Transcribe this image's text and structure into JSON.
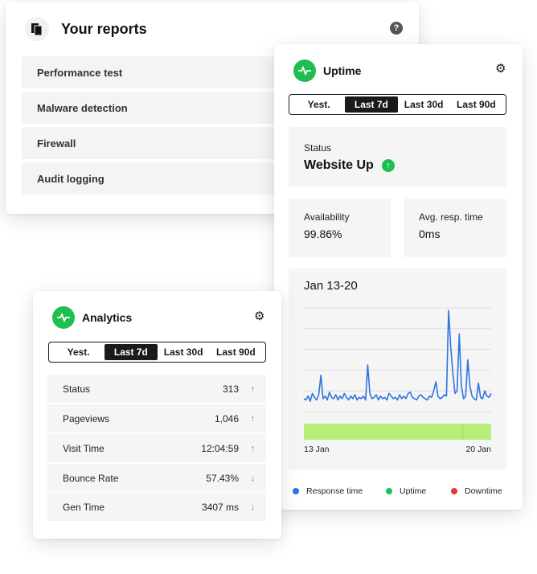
{
  "reports": {
    "title": "Your reports",
    "items": [
      "Performance test",
      "Malware detection",
      "Firewall",
      "Audit logging"
    ]
  },
  "uptime": {
    "title": "Uptime",
    "tabs": [
      "Yest.",
      "Last 7d",
      "Last 30d",
      "Last 90d"
    ],
    "active_tab": "Last 7d",
    "status_label": "Status",
    "status_value": "Website Up",
    "availability_label": "Availability",
    "availability_value": "99.86%",
    "resp_label": "Avg. resp. time",
    "resp_value": "0ms",
    "chart_title": "Jan 13-20",
    "x_start": "13 Jan",
    "x_end": "20 Jan",
    "legend": [
      {
        "label": "Response time",
        "color": "#2f74e0"
      },
      {
        "label": "Uptime",
        "color": "#1fbe4f"
      },
      {
        "label": "Downtime",
        "color": "#e53935"
      }
    ]
  },
  "analytics": {
    "title": "Analytics",
    "tabs": [
      "Yest.",
      "Last 7d",
      "Last 30d",
      "Last 90d"
    ],
    "active_tab": "Last 7d",
    "rows": [
      {
        "name": "Status",
        "value": "313",
        "trend": "up"
      },
      {
        "name": "Pageviews",
        "value": "1,046",
        "trend": "up"
      },
      {
        "name": "Visit Time",
        "value": "12:04:59",
        "trend": "up"
      },
      {
        "name": "Bounce Rate",
        "value": "57.43%",
        "trend": "down"
      },
      {
        "name": "Gen Time",
        "value": "3407 ms",
        "trend": "down"
      }
    ]
  },
  "colors": {
    "accent_green": "#1fbe4f",
    "uptime_bar": "#b5ef7a",
    "line_blue": "#2f74e0"
  },
  "chart_data": {
    "type": "line",
    "title": "Jan 13-20",
    "x_range": [
      "13 Jan",
      "20 Jan"
    ],
    "grid": true,
    "series": [
      {
        "name": "Response time",
        "values": [
          10,
          9,
          12,
          8,
          14,
          11,
          9,
          13,
          28,
          10,
          12,
          9,
          15,
          11,
          10,
          13,
          9,
          12,
          10,
          14,
          11,
          9,
          12,
          10,
          13,
          9,
          11,
          10,
          12,
          9,
          36,
          14,
          10,
          11,
          13,
          9,
          12,
          10,
          11,
          9,
          14,
          12,
          10,
          11,
          9,
          13,
          10,
          12,
          10,
          14,
          15,
          11,
          10,
          9,
          12,
          13,
          11,
          10,
          9,
          12,
          11,
          16,
          23,
          12,
          10,
          11,
          13,
          12,
          78,
          50,
          30,
          14,
          16,
          60,
          20,
          10,
          12,
          40,
          20,
          12,
          10,
          9,
          22,
          11,
          10,
          16,
          12,
          11,
          14
        ]
      },
      {
        "name": "Uptime",
        "values": [
          100
        ]
      }
    ]
  }
}
